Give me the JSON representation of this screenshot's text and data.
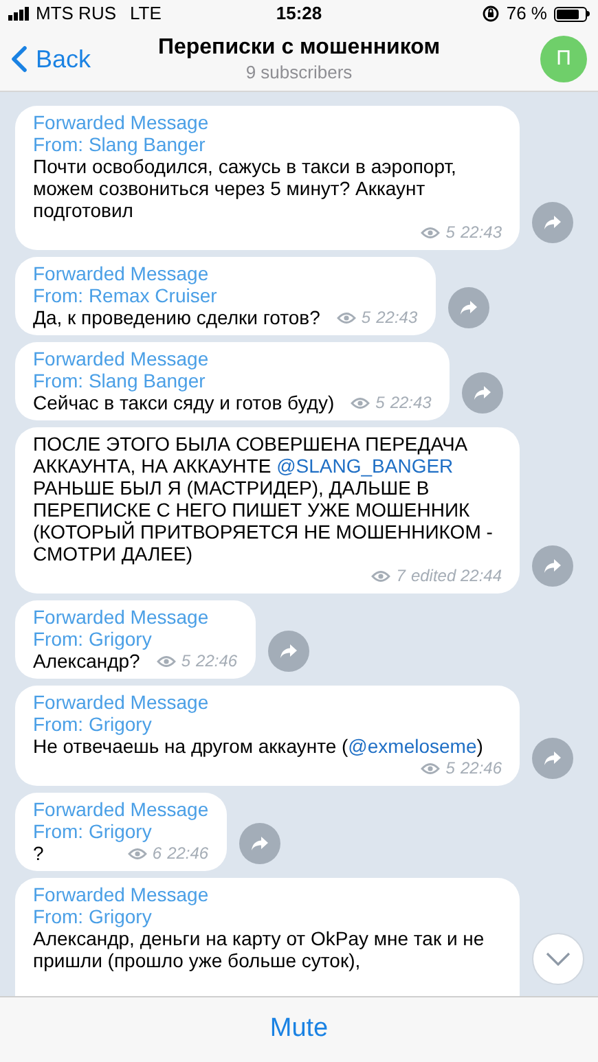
{
  "status_bar": {
    "carrier": "MTS RUS",
    "network": "LTE",
    "time": "15:28",
    "battery": "76 %"
  },
  "header": {
    "back": "Back",
    "title": "Переписки с мошенником",
    "subtitle": "9 subscribers",
    "avatar": "П"
  },
  "messages": [
    {
      "forwarded": "Forwarded Message",
      "from": "From: Slang Banger",
      "parts": [
        {
          "kind": "text",
          "text": "Почти освободился, сажусь в такси в аэропорт, можем созвониться через 5 минут? Аккаунт подготовил"
        }
      ],
      "views": "5",
      "time": "22:43"
    },
    {
      "forwarded": "Forwarded Message",
      "from": "From: Remax Cruiser",
      "parts": [
        {
          "kind": "text",
          "text": "Да, к проведению сделки готов?"
        }
      ],
      "views": "5",
      "time": "22:43"
    },
    {
      "forwarded": "Forwarded Message",
      "from": "From: Slang Banger",
      "parts": [
        {
          "kind": "text",
          "text": "Сейчас в такси сяду и готов буду)"
        }
      ],
      "views": "5",
      "time": "22:43"
    },
    {
      "parts": [
        {
          "kind": "text",
          "text": "ПОСЛЕ ЭТОГО БЫЛА СОВЕРШЕНА ПЕРЕДАЧА АККАУНТА, НА АККАУНТЕ "
        },
        {
          "kind": "mention",
          "text": "@SLANG_BANGER"
        },
        {
          "kind": "text",
          "text": " РАНЬШЕ БЫЛ Я (МАСТРИДЕР), ДАЛЬШЕ В ПЕРЕПИСКЕ С НЕГО ПИШЕТ УЖЕ МОШЕННИК (КОТОРЫЙ ПРИТВОРЯЕТСЯ НЕ МОШЕННИКОМ - СМОТРИ ДАЛЕЕ)"
        }
      ],
      "views": "7",
      "time": "edited 22:44"
    },
    {
      "forwarded": "Forwarded Message",
      "from": "From: Grigory",
      "parts": [
        {
          "kind": "text",
          "text": "Александр?"
        }
      ],
      "views": "5",
      "time": "22:46"
    },
    {
      "forwarded": "Forwarded Message",
      "from": "From: Grigory",
      "parts": [
        {
          "kind": "text",
          "text": "Не отвечаешь на другом аккаунте ("
        },
        {
          "kind": "mention",
          "text": "@exmeloseme"
        },
        {
          "kind": "text",
          "text": ")"
        }
      ],
      "views": "5",
      "time": "22:46"
    },
    {
      "forwarded": "Forwarded Message",
      "from": "From: Grigory",
      "parts": [
        {
          "kind": "text",
          "text": "?"
        }
      ],
      "views": "6",
      "time": "22:46"
    },
    {
      "forwarded": "Forwarded Message",
      "from": "From: Grigory",
      "parts": [
        {
          "kind": "text",
          "text": "Александр, деньги на карту от OkPay мне так и не пришли (прошло уже больше суток),"
        }
      ]
    }
  ],
  "bottom_bar": {
    "button": "Mute"
  }
}
